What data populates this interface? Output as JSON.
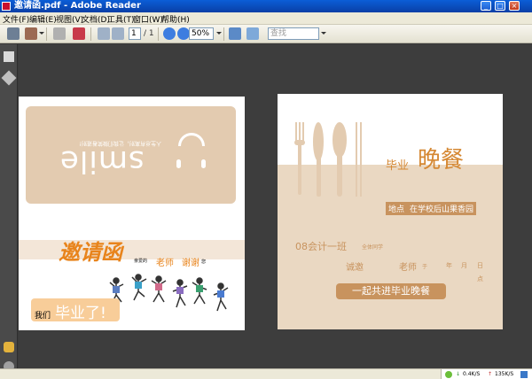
{
  "window": {
    "title": "邀请函.pdf - Adobe Reader"
  },
  "menu": [
    "文件(F)",
    "编辑(E)",
    "视图(V)",
    "文档(D)",
    "工具(T)",
    "窗口(W)",
    "帮助(H)"
  ],
  "toolbar": {
    "page_current": "1",
    "page_total": "/ 1",
    "zoom": "50%",
    "search_placeholder": "查找"
  },
  "page1": {
    "smile": "smile",
    "smile_subtext": "人生总有离别，让我们微笑着道别！",
    "calligraphy": "邀请函",
    "tiny_before": "亲爱的",
    "teacher": "老师",
    "thanks": "谢谢",
    "tiny_after": "您",
    "we": "我们",
    "graduate": "毕业了!"
  },
  "page2": {
    "graduation": "毕业",
    "dinner": "晚餐",
    "location_label": "地点",
    "location_value": "在学校后山果香园",
    "class_name": "08会计一班",
    "all_students": "全体同学",
    "invite": "诚邀",
    "teacher": "老师",
    "yu": "于",
    "year": "年",
    "month": "月",
    "day": "日",
    "hour": "点",
    "banner": "一起共进毕业晚餐"
  },
  "statusbar": {
    "down": "0.4K/S",
    "up": "135K/S"
  },
  "colors": {
    "accent": "#e8841c",
    "tan": "#c8935e"
  }
}
